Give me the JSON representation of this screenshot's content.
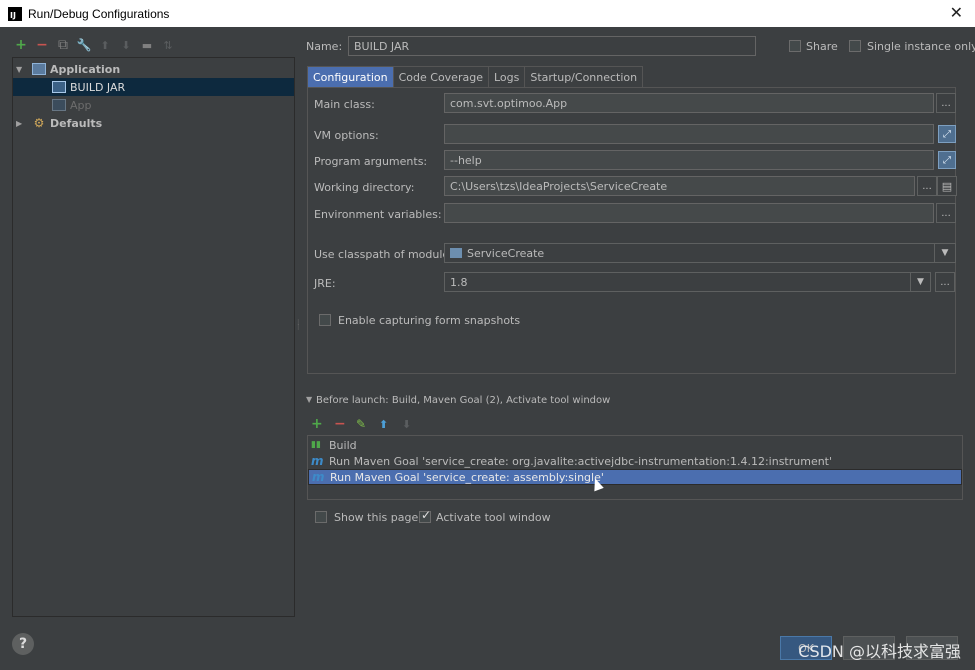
{
  "window": {
    "title": "Run/Debug Configurations",
    "app_icon": "IJ",
    "close_glyph": "✕"
  },
  "left_toolbar": {
    "add": "+",
    "remove": "−",
    "copy": "⧉",
    "edit_defaults": "🔧",
    "move_up": "⬆",
    "move_down": "⬇",
    "folder": "▬",
    "sort": "⇅"
  },
  "tree": {
    "application": {
      "label": "Application",
      "expanded": true
    },
    "build_jar": {
      "label": "BUILD JAR",
      "selected": true
    },
    "app": {
      "label": "App"
    },
    "defaults": {
      "label": "Defaults",
      "expanded": false
    }
  },
  "header": {
    "name_label": "Name:",
    "name_value": "BUILD JAR",
    "share_label": "Share",
    "single_instance_label": "Single instance only"
  },
  "tabs": [
    "Configuration",
    "Code Coverage",
    "Logs",
    "Startup/Connection"
  ],
  "config": {
    "main_class_label": "Main class:",
    "main_class_value": "com.svt.optimoo.App",
    "vm_options_label": "VM options:",
    "vm_options_value": "",
    "program_args_label": "Program arguments:",
    "program_args_value": "--help",
    "working_dir_label": "Working directory:",
    "working_dir_value": "C:\\Users\\tzs\\IdeaProjects\\ServiceCreate",
    "env_vars_label": "Environment variables:",
    "env_vars_value": "",
    "classpath_label": "Use classpath of module:",
    "classpath_value": "ServiceCreate",
    "jre_label": "JRE:",
    "jre_value": "1.8",
    "snapshot_label": "Enable capturing form snapshots",
    "ellipsis": "...",
    "dropdown_arrow": "▼",
    "expand_glyph": "⤢"
  },
  "before_launch": {
    "header": "Before launch: Build, Maven Goal (2), Activate tool window",
    "toolbar": {
      "add": "+",
      "remove": "−",
      "edit": "✎",
      "up": "⬆",
      "down": "⬇"
    },
    "items": [
      {
        "icon": "build-icon",
        "label": "Build"
      },
      {
        "icon": "maven-icon",
        "label": "Run Maven Goal 'service_create: org.javalite:activejdbc-instrumentation:1.4.12:instrument'"
      },
      {
        "icon": "maven-icon",
        "label": "Run Maven Goal 'service_create: assembly:single'"
      }
    ],
    "show_page_label": "Show this page",
    "activate_window_label": "Activate tool window"
  },
  "footer": {
    "help": "?",
    "ok": "OK",
    "cancel": "",
    "apply": ""
  },
  "watermark": "CSDN @以科技求富强",
  "colors": {
    "background": "#3c3f41",
    "field_bg": "#45494a",
    "selection": "#4b6eaf",
    "tree_selection": "#0d293e",
    "green": "#4fa84a",
    "red": "#c75450"
  }
}
